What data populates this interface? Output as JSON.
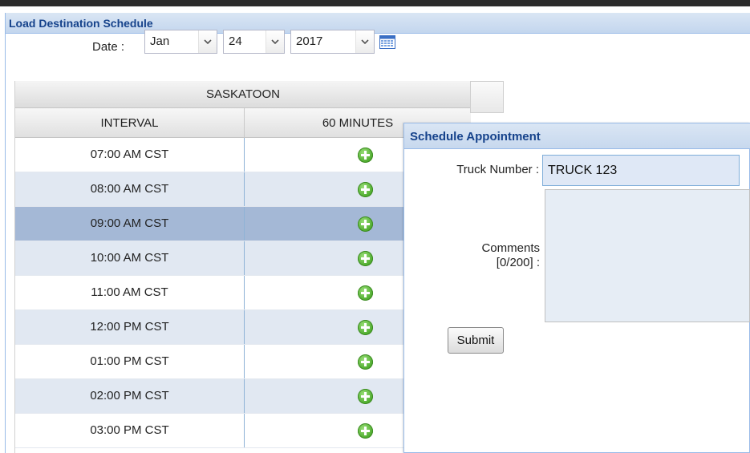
{
  "panel": {
    "title": "Load Destination Schedule"
  },
  "date": {
    "label": "Date :",
    "month": "Jan",
    "day": "24",
    "year": "2017"
  },
  "grid": {
    "location": "SASKATOON",
    "columns": [
      "INTERVAL",
      "60 MINUTES"
    ],
    "rows": [
      {
        "interval": "07:00 AM CST"
      },
      {
        "interval": "08:00 AM CST"
      },
      {
        "interval": "09:00 AM CST"
      },
      {
        "interval": "10:00 AM CST"
      },
      {
        "interval": "11:00 AM CST"
      },
      {
        "interval": "12:00 PM CST"
      },
      {
        "interval": "01:00 PM CST"
      },
      {
        "interval": "02:00 PM CST"
      },
      {
        "interval": "03:00 PM CST"
      }
    ],
    "selected_row": "09:00 AM CST"
  },
  "dialog": {
    "title": "Schedule Appointment",
    "truck_label": "Truck Number :",
    "truck_value": "TRUCK 123",
    "comments_label_line1": "Comments",
    "comments_label_line2": "[0/200] :",
    "comments_value": "",
    "submit_label": "Submit"
  },
  "colors": {
    "header_text": "#15428b",
    "selected_row": "#a4b8d6",
    "alt_row": "#e1e8f2",
    "add_icon": "#4caa2c"
  }
}
